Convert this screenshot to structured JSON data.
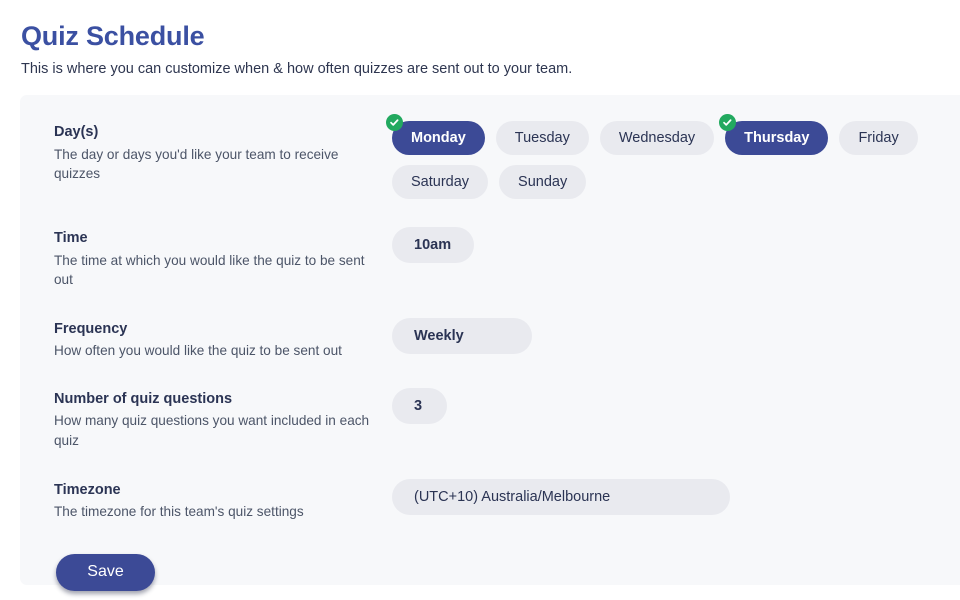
{
  "header": {
    "title": "Quiz Schedule",
    "subtitle": "This is where you can customize when & how often quizzes are sent out to your team."
  },
  "colors": {
    "title": "#3b50a2",
    "accent": "#3c4a96",
    "pill_unselected_bg": "#e9eaef",
    "check_badge": "#22a95f",
    "card_bg": "#f7f8fa",
    "page_bg": "#ffffff",
    "label_text": "#2b3454",
    "desc_text": "#4c5568"
  },
  "settings": {
    "days": {
      "label": "Day(s)",
      "description": "The day or days you'd like your team to receive quizzes",
      "options": [
        {
          "label": "Monday",
          "selected": true
        },
        {
          "label": "Tuesday",
          "selected": false
        },
        {
          "label": "Wednesday",
          "selected": false
        },
        {
          "label": "Thursday",
          "selected": true
        },
        {
          "label": "Friday",
          "selected": false
        },
        {
          "label": "Saturday",
          "selected": false
        },
        {
          "label": "Sunday",
          "selected": false
        }
      ]
    },
    "time": {
      "label": "Time",
      "description": "The time at which you would like the quiz to be sent out",
      "value": "10am"
    },
    "frequency": {
      "label": "Frequency",
      "description": "How often you would like the quiz to be sent out",
      "value": "Weekly"
    },
    "question_count": {
      "label": "Number of quiz questions",
      "description": "How many quiz questions you want included in each quiz",
      "value": "3"
    },
    "timezone": {
      "label": "Timezone",
      "description": "The timezone for this team's quiz settings",
      "value": "(UTC+10) Australia/Melbourne"
    }
  },
  "actions": {
    "save_label": "Save"
  },
  "icons": {
    "check": "check-icon"
  }
}
